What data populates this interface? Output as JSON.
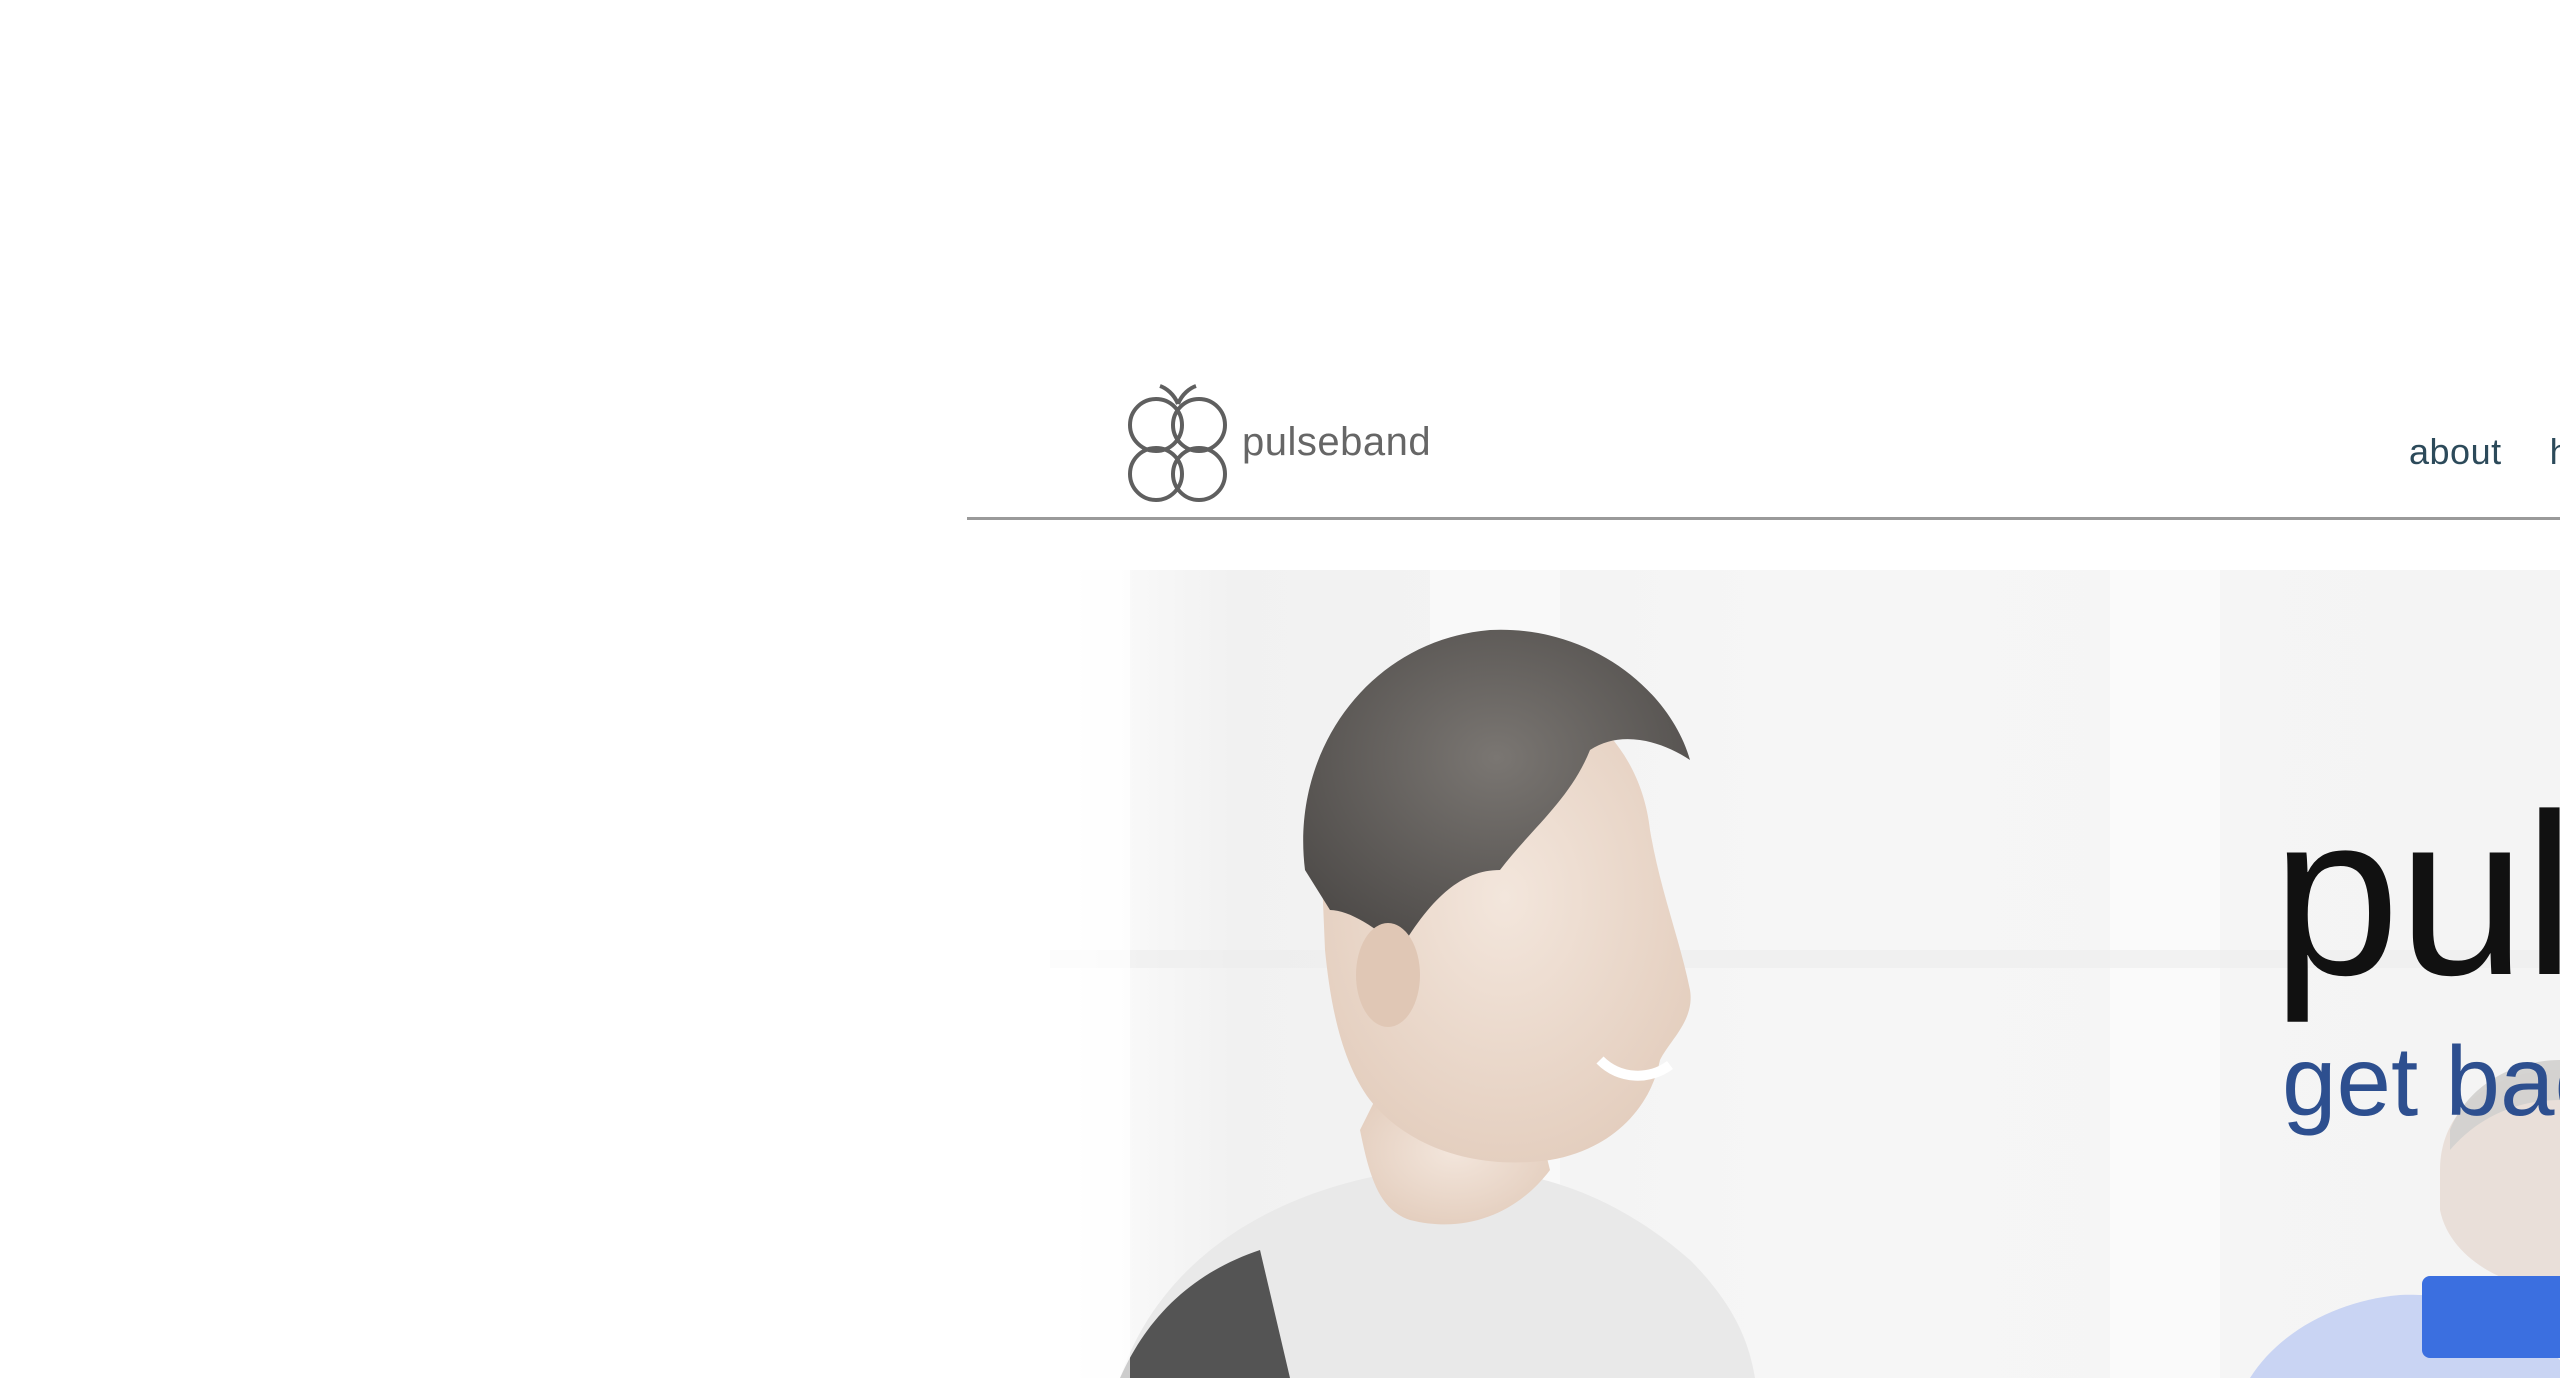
{
  "brand": {
    "name": "pulseband",
    "logo_icon": "four-loop-logo-icon"
  },
  "nav": {
    "items": [
      {
        "label": "about"
      },
      {
        "label": "how it works"
      }
    ]
  },
  "hero": {
    "title": "pulseband",
    "subtitle": "get back on track",
    "cta_label": "",
    "image": "two-smiling-men-in-gym-photo",
    "colors": {
      "title": "#111111",
      "subtitle": "#2d4f8f",
      "cta": "#3b6fe0"
    }
  },
  "colors": {
    "nav_text": "#2c4a5a",
    "logo_text": "#666666",
    "divider": "#9a9a9a"
  }
}
